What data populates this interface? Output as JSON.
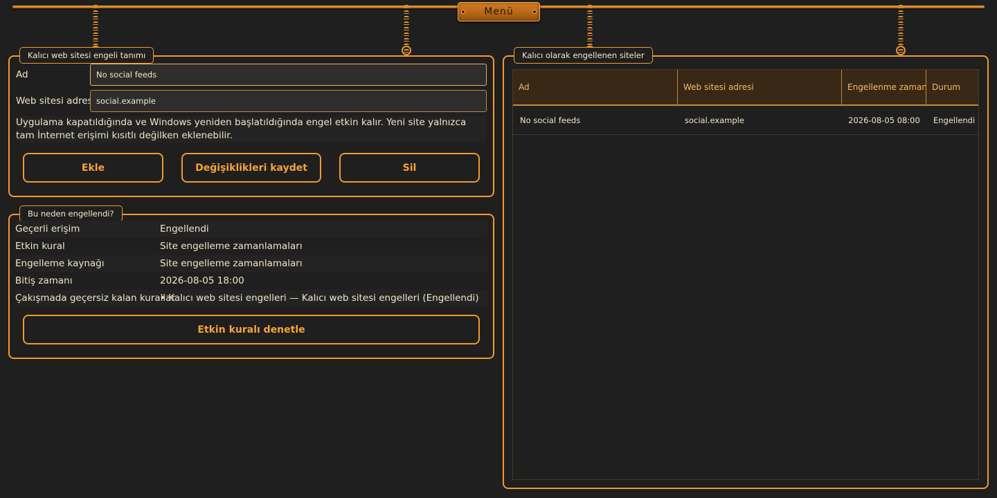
{
  "menu": {
    "label": "Menü"
  },
  "definition_panel": {
    "title": "Kalıcı web sitesi engeli tanımı",
    "name_label": "Ad",
    "name_value": "No social feeds",
    "url_label": "Web sitesi adresi",
    "url_value": "social.example",
    "note": "Uygulama kapatıldığında ve Windows yeniden başlatıldığında engel etkin kalır. Yeni site yalnızca tam İnternet erişimi kısıtlı değilken eklenebilir.",
    "add_label": "Ekle",
    "save_label": "Değişiklikleri kaydet",
    "delete_label": "Sil"
  },
  "why_panel": {
    "title": "Bu neden engellendi?",
    "rows": [
      {
        "key": "Geçerli erişim",
        "value": "Engellendi"
      },
      {
        "key": "Etkin kural",
        "value": "Site engelleme zamanlamaları"
      },
      {
        "key": "Engelleme kaynağı",
        "value": "Site engelleme zamanlamaları"
      },
      {
        "key": "Bitiş zamanı",
        "value": "2026-08-05 18:00"
      },
      {
        "key": "Çakışmada geçersiz kalan kurallar",
        "value": "• Kalıcı web sitesi engelleri — Kalıcı web sitesi engelleri (Engellendi)"
      }
    ],
    "inspect_label": "Etkin kuralı denetle"
  },
  "list_panel": {
    "title": "Kalıcı olarak engellenen siteler",
    "columns": [
      "Ad",
      "Web sitesi adresi",
      "Engellenme zamanı",
      "Durum"
    ],
    "rows": [
      [
        "No social feeds",
        "social.example",
        "2026-08-05 08:00",
        "Engellendi"
      ]
    ]
  },
  "colors": {
    "accent": "#f29a2e",
    "background": "#1f1f1f",
    "text": "#f1e6c6",
    "header_bg": "#3a2816"
  }
}
